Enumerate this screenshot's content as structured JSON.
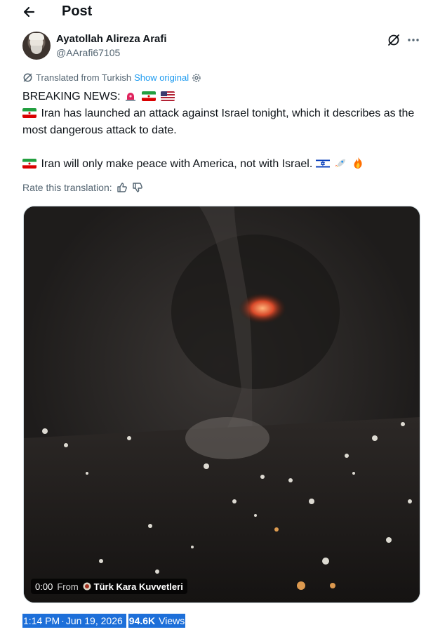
{
  "header": {
    "title": "Post"
  },
  "author": {
    "name": "Ayatollah Alireza Arafi",
    "handle": "@AArafi67105"
  },
  "translation": {
    "label": "Translated from Turkish",
    "show_original": "Show original"
  },
  "tweet": {
    "line1": "BREAKING NEWS:",
    "line2": "Iran has launched an attack against Israel tonight, which it describes as the most dangerous attack to date.",
    "line3": "Iran will only make peace with America, not with Israel."
  },
  "rate": {
    "label": "Rate this translation:"
  },
  "media": {
    "time": "0:00",
    "from_label": "From",
    "source": "Türk Kara Kuvvetleri"
  },
  "meta": {
    "time": "1:14 PM",
    "separator": "·",
    "date": "Jun 19, 2026",
    "views_count": "94.6K",
    "views_label": "Views"
  },
  "icons": {
    "back": "arrow-left-icon",
    "grok": "grok-icon",
    "more": "more-icon",
    "translate": "translate-icon",
    "settings": "settings-icon",
    "thumbs_up": "thumbs-up-icon",
    "thumbs_down": "thumbs-down-icon"
  }
}
